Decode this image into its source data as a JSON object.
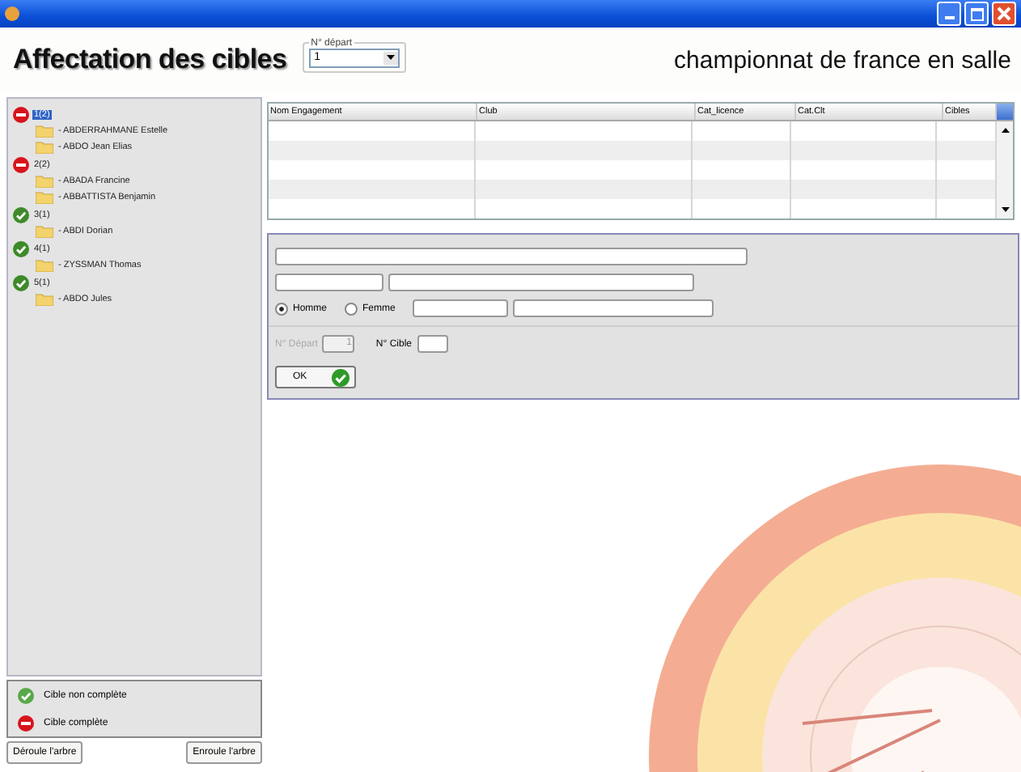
{
  "header": {
    "title": "Affectation des cibles",
    "depart_group": {
      "legend": "N° départ",
      "value": "1"
    },
    "event_title": "championnat de france en salle"
  },
  "tree": [
    {
      "label": "1(2)",
      "complete": true,
      "selected": true,
      "children": [
        "- ABDERRAHMANE Estelle",
        "- ABDO Jean Elias"
      ]
    },
    {
      "label": "2(2)",
      "complete": true,
      "selected": false,
      "children": [
        "- ABADA Francine",
        "- ABBATTISTA Benjamin"
      ]
    },
    {
      "label": "3(1)",
      "complete": false,
      "selected": false,
      "children": [
        "- ABDI Dorian"
      ]
    },
    {
      "label": "4(1)",
      "complete": false,
      "selected": false,
      "children": [
        "- ZYSSMAN Thomas"
      ]
    },
    {
      "label": "5(1)",
      "complete": false,
      "selected": false,
      "children": [
        "- ABDO Jules"
      ]
    }
  ],
  "legend": [
    {
      "label": "Cible non complète",
      "complete": false
    },
    {
      "label": "Cible complète",
      "complete": true
    }
  ],
  "tree_buttons": [
    "Déroule l'arbre",
    "Enroule l'arbre"
  ],
  "table": {
    "columns": [
      "Nom Engagement",
      "Club",
      "Cat_licence",
      "Cat.Clt",
      "Cibles"
    ]
  },
  "form": {
    "gender": [
      {
        "label": "Homme",
        "selected": true
      },
      {
        "label": "Femme",
        "selected": false
      }
    ],
    "depart": {
      "label": "N° Départ",
      "value": "1",
      "disabled": true
    },
    "cible": {
      "label": "N° Cible",
      "disabled": false
    },
    "ok_button": "OK"
  }
}
